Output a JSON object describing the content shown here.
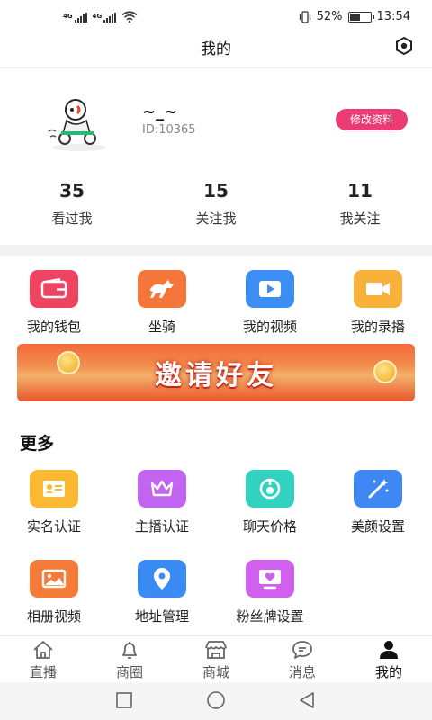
{
  "status_bar": {
    "network1": "4G",
    "network2": "4G",
    "battery": "52%",
    "battery_level": 0.52,
    "time": "13:54"
  },
  "header": {
    "title": "我的",
    "settings_icon": "hexagon-settings-icon"
  },
  "profile": {
    "nickname": "~_~",
    "id_text": "ID:10365",
    "edit_label": "修改资料"
  },
  "stats": [
    {
      "value": "35",
      "label": "看过我"
    },
    {
      "value": "15",
      "label": "关注我"
    },
    {
      "value": "11",
      "label": "我关注"
    }
  ],
  "quick_items": [
    {
      "label": "我的钱包",
      "icon": "wallet-icon",
      "color": "#ef4362"
    },
    {
      "label": "坐骑",
      "icon": "horse-icon",
      "color": "#f4763a"
    },
    {
      "label": "我的视频",
      "icon": "video-play-icon",
      "color": "#3c8ef5"
    },
    {
      "label": "我的录播",
      "icon": "camera-icon",
      "color": "#f8b23a"
    }
  ],
  "banner": {
    "text": "邀请好友"
  },
  "more": {
    "title": "更多",
    "items": [
      {
        "label": "实名认证",
        "icon": "id-card-icon",
        "color": "#fbb832"
      },
      {
        "label": "主播认证",
        "icon": "crown-icon",
        "color": "#c264f2"
      },
      {
        "label": "聊天价格",
        "icon": "chat-price-icon",
        "color": "#33d1c0"
      },
      {
        "label": "美颜设置",
        "icon": "magic-wand-icon",
        "color": "#3f87f2"
      },
      {
        "label": "相册视频",
        "icon": "album-icon",
        "color": "#f57b38"
      },
      {
        "label": "地址管理",
        "icon": "location-pin-icon",
        "color": "#3a8cf4"
      },
      {
        "label": "粉丝牌设置",
        "icon": "fan-badge-icon",
        "color": "#d160ef"
      }
    ]
  },
  "tabs": [
    {
      "label": "直播",
      "icon": "home-icon"
    },
    {
      "label": "商圈",
      "icon": "bell-icon"
    },
    {
      "label": "商城",
      "icon": "store-icon"
    },
    {
      "label": "消息",
      "icon": "message-icon"
    },
    {
      "label": "我的",
      "icon": "user-icon",
      "active": true
    }
  ]
}
